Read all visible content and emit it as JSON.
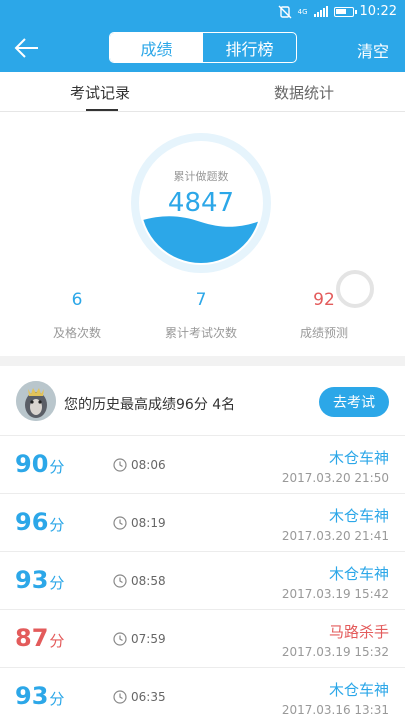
{
  "status_bar": {
    "network": "4G",
    "time": "10:22"
  },
  "header": {
    "tabs": [
      {
        "label": "成绩",
        "active": true
      },
      {
        "label": "排行榜",
        "active": false
      }
    ],
    "clear_label": "清空"
  },
  "subtabs": [
    {
      "label": "考试记录",
      "active": true
    },
    {
      "label": "数据统计",
      "active": false
    }
  ],
  "gauge": {
    "label": "累计做题数",
    "value": "4847"
  },
  "stats": [
    {
      "value": "6",
      "label": "及格次数"
    },
    {
      "value": "7",
      "label": "累计考试次数"
    },
    {
      "value": "92",
      "label": "成绩预测"
    }
  ],
  "best": {
    "text": "您的历史最高成绩96分  4名",
    "button_label": "去考试"
  },
  "records": [
    {
      "score": "90",
      "unit": "分",
      "duration": "08:06",
      "title": "木仓车神",
      "datetime": "2017.03.20  21:50",
      "status": "pass"
    },
    {
      "score": "96",
      "unit": "分",
      "duration": "08:19",
      "title": "木仓车神",
      "datetime": "2017.03.20  21:41",
      "status": "pass"
    },
    {
      "score": "93",
      "unit": "分",
      "duration": "08:58",
      "title": "木仓车神",
      "datetime": "2017.03.19  15:42",
      "status": "pass"
    },
    {
      "score": "87",
      "unit": "分",
      "duration": "07:59",
      "title": "马路杀手",
      "datetime": "2017.03.19  15:32",
      "status": "fail"
    },
    {
      "score": "93",
      "unit": "分",
      "duration": "06:35",
      "title": "木仓车神",
      "datetime": "2017.03.16  13:31",
      "status": "pass"
    }
  ],
  "colors": {
    "accent": "#2ca7e8",
    "fail": "#e35b5b",
    "muted": "#999999"
  }
}
